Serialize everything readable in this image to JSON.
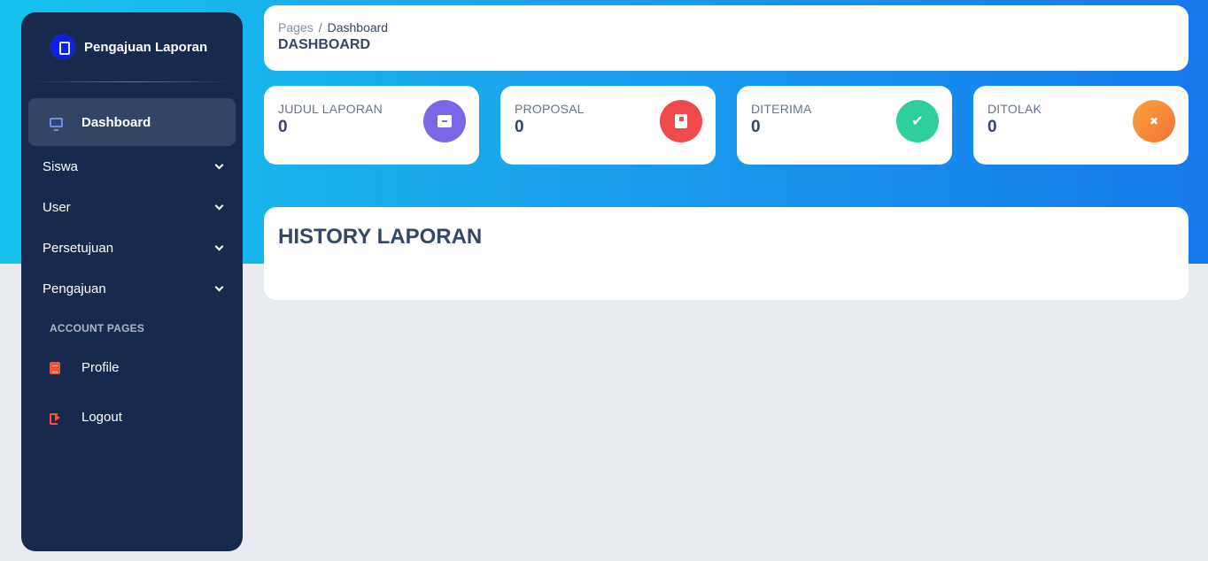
{
  "brand": {
    "name": "Pengajuan Laporan"
  },
  "sidebar": {
    "active": {
      "label": "Dashboard",
      "icon": "monitor-icon"
    },
    "items": [
      {
        "label": "Siswa"
      },
      {
        "label": "User"
      },
      {
        "label": "Persetujuan"
      },
      {
        "label": "Pengajuan"
      }
    ],
    "account_title": "ACCOUNT PAGES",
    "account": [
      {
        "label": "Profile",
        "icon": "document-icon"
      },
      {
        "label": "Logout",
        "icon": "logout-icon"
      }
    ]
  },
  "header": {
    "breadcrumb_root": "Pages",
    "breadcrumb_sep": "/",
    "breadcrumb_current": "Dashboard",
    "title": "DASHBOARD"
  },
  "stats": [
    {
      "label": "JUDUL LAPORAN",
      "value": "0",
      "icon": "archive-icon",
      "color": "#7b67e6"
    },
    {
      "label": "PROPOSAL",
      "value": "0",
      "icon": "book-icon",
      "color": "#f04a4f"
    },
    {
      "label": "DITERIMA",
      "value": "0",
      "icon": "check-icon",
      "color": "#2fcf9d"
    },
    {
      "label": "DITOLAK",
      "value": "0",
      "icon": "close-icon",
      "color": "#f7723a"
    }
  ],
  "stat_glyphs": {
    "check": "✔",
    "close": "✖"
  },
  "history": {
    "title": "HISTORY LAPORAN"
  },
  "colors": {
    "sidebar": "#172a4d",
    "hero_start": "#17c3ee",
    "hero_end": "#1679ec",
    "text": "#344767"
  }
}
